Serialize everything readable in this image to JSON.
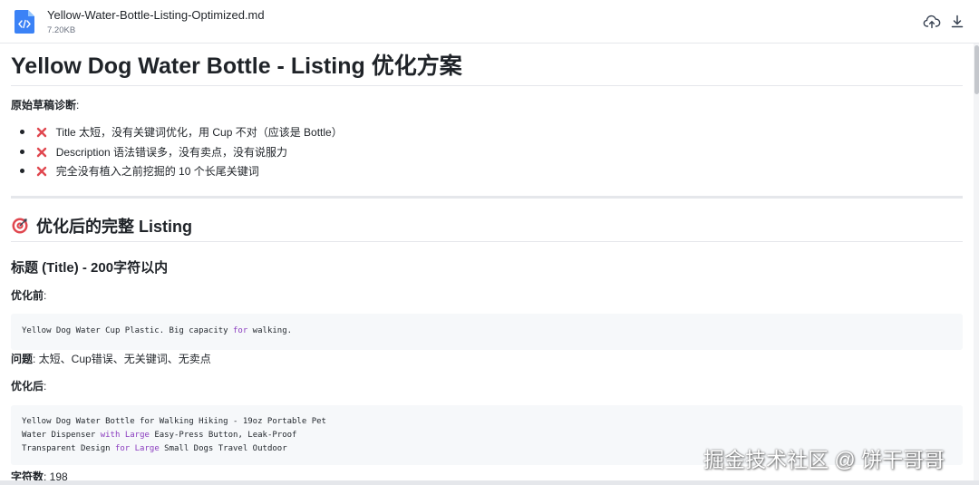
{
  "file": {
    "name": "Yellow-Water-Bottle-Listing-Optimized.md",
    "size": "7.20KB",
    "icon": "code-file-icon",
    "icon_color": "#3b82f6"
  },
  "toolbar": {
    "upload_icon": "cloud-upload-icon",
    "download_icon": "download-icon"
  },
  "doc": {
    "title": "Yellow Dog Water Bottle - Listing 优化方案",
    "diagnosis": {
      "label": "原始草稿诊断",
      "colon": ":",
      "items": [
        "Title 太短，没有关键词优化，用 Cup 不对（应该是 Bottle）",
        "Description 语法错误多，没有卖点，没有说服力",
        "完全没有植入之前挖掘的 10 个长尾关键词"
      ],
      "item_icon": "red-x-icon",
      "item_icon_color": "#e0474f"
    },
    "section_title": "优化后的完整 Listing",
    "section_icon": "target-icon",
    "subsection_title": "标题 (Title) - 200字符以内",
    "before": {
      "label": "优化前",
      "colon": ":",
      "code_segments": [
        {
          "text": "Yellow Dog Water Cup Plastic. Big capacity ",
          "kw": false
        },
        {
          "text": "for",
          "kw": true
        },
        {
          "text": " walking.",
          "kw": false
        }
      ]
    },
    "problem": {
      "label": "问题",
      "text": ": 太短、Cup错误、无关键词、无卖点"
    },
    "after": {
      "label": "优化后",
      "colon": ":",
      "code_lines": [
        [
          {
            "text": "Yellow Dog Water Bottle for Walking Hiking - 19oz Portable Pet",
            "kw": false
          }
        ],
        [
          {
            "text": "Water Dispenser ",
            "kw": false
          },
          {
            "text": "with",
            "kw": true
          },
          {
            "text": " ",
            "kw": false
          },
          {
            "text": "Large",
            "kw": true
          },
          {
            "text": " Easy-Press Button, Leak-Proof",
            "kw": false
          }
        ],
        [
          {
            "text": "Transparent Design ",
            "kw": false
          },
          {
            "text": "for",
            "kw": true
          },
          {
            "text": " ",
            "kw": false
          },
          {
            "text": "Large",
            "kw": true
          },
          {
            "text": " Small Dogs Travel Outdoor",
            "kw": false
          }
        ]
      ]
    },
    "char_count": {
      "label": "字符数",
      "text": ": 198"
    },
    "keyword_color": "#8b3dbf"
  },
  "watermark": "掘金技术社区 @ 饼干哥哥"
}
